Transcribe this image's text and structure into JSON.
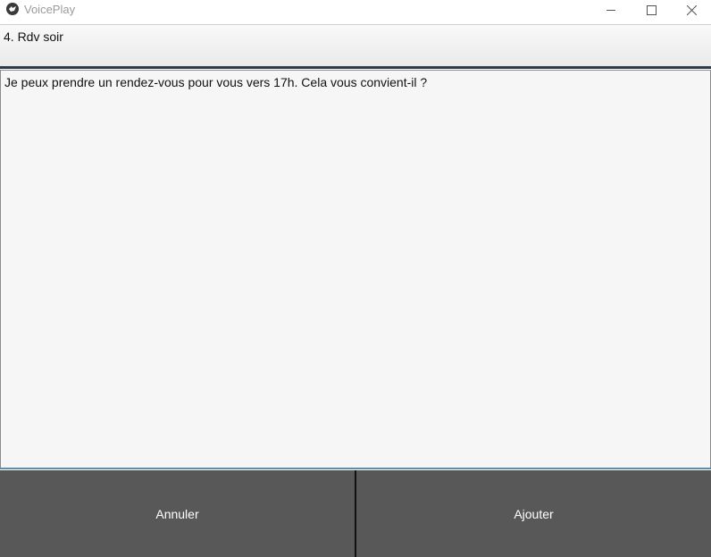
{
  "window": {
    "title": "VoicePlay",
    "icon": "app-logo-icon",
    "controls": [
      "minimize-icon",
      "maximize-icon",
      "close-icon"
    ]
  },
  "form": {
    "title_value": "4. Rdv soir",
    "message_value": "Je peux prendre un rendez-vous pour vous vers 17h. Cela vous convient-il ?"
  },
  "actions": {
    "cancel_label": "Annuler",
    "add_label": "Ajouter"
  },
  "colors": {
    "button_bg": "#585858",
    "button_text": "#ffffff",
    "field_bg": "#f6f6f6",
    "accent_line": "#5a8fa8"
  }
}
